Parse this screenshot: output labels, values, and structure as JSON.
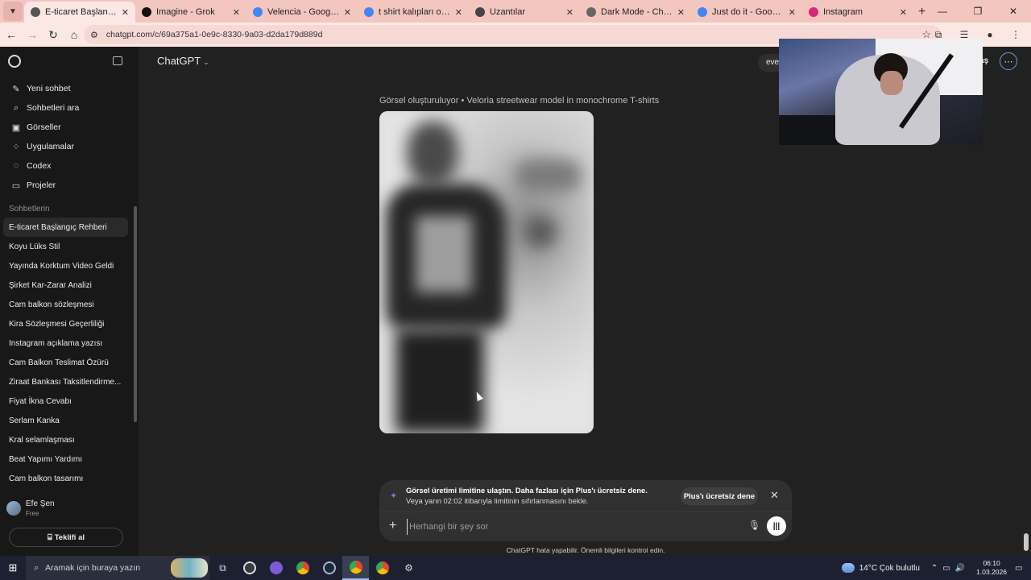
{
  "browser": {
    "tabs": [
      {
        "title": "E-ticaret Başlangıç Rehbe",
        "active": true,
        "favicon_color": "#555555"
      },
      {
        "title": "Imagine - Grok",
        "active": false,
        "favicon_color": "#111111"
      },
      {
        "title": "Velencia - Google'da Ara",
        "active": false,
        "favicon_color": "#4285f4"
      },
      {
        "title": "t shirt kalıpları owersize -",
        "active": false,
        "favicon_color": "#4285f4"
      },
      {
        "title": "Uzantılar",
        "active": false,
        "favicon_color": "#444444"
      },
      {
        "title": "Dark Mode - Chrome We",
        "active": false,
        "favicon_color": "#666666"
      },
      {
        "title": "Just do it - Google'da Ara",
        "active": false,
        "favicon_color": "#4285f4"
      },
      {
        "title": "Instagram",
        "active": false,
        "favicon_color": "#d62976"
      }
    ],
    "url": "chatgpt.com/c/69a375a1-0e9c-8330-9a03-d2da179d889d"
  },
  "sidebar": {
    "nav": [
      {
        "label": "Yeni sohbet",
        "icon": "✎"
      },
      {
        "label": "Sohbetleri ara",
        "icon": "⌕"
      },
      {
        "label": "Görseller",
        "icon": "▣"
      },
      {
        "label": "Uygulamalar",
        "icon": "⁘"
      },
      {
        "label": "Codex",
        "icon": "◌"
      },
      {
        "label": "Projeler",
        "icon": "▭"
      }
    ],
    "section_label": "Sohbetlerin",
    "chats": [
      "E-ticaret Başlangıç Rehberi",
      "Koyu Lüks Stil",
      "Yayında Korktum Video Geldi",
      "Şirket Kar-Zarar Analizi",
      "Cam balkon sözleşmesi",
      "Kira Sözleşmesi Geçerliliği",
      "Instagram açıklama yazısı",
      "Cam Balkon Teslimat Özürü",
      "Ziraat Bankası Taksitlendirme...",
      "Fiyat İkna Cevabı",
      "Serlam Kanka",
      "Kral selamlaşması",
      "Beat Yapımı Yardımı",
      "Cam balkon tasarımı"
    ],
    "user": {
      "name": "Efe Şen",
      "plan": "Free"
    },
    "gift_button": "Teklifi al"
  },
  "header": {
    "model": "ChatGPT",
    "share_partial": "eve",
    "right_partial": "daş"
  },
  "content": {
    "caption": "Görsel oluşturuluyor • Veloria streetwear model in monochrome T-shirts",
    "limit_bold": "Görsel üretimi limitine ulaştın. Daha fazlası için Plus'ı ücretsiz dene.",
    "limit_rest": " Veya yarın 02:02 itibarıyla limitinin sıfırlanmasını bekle.",
    "plus_button": "Plus'ı ücretsiz dene",
    "input_placeholder": "Herhangi bir şey sor",
    "disclaimer": "ChatGPT hata yapabilir. Önemli bilgileri kontrol edin."
  },
  "taskbar": {
    "search_placeholder": "Aramak için buraya yazın",
    "weather": "14°C  Çok bulutlu",
    "time": "06:10",
    "date": "1.03.2026"
  },
  "colors": {
    "accent": "#8a6df0",
    "tabbar": "#f3c6c0",
    "app_bg": "#212121"
  }
}
